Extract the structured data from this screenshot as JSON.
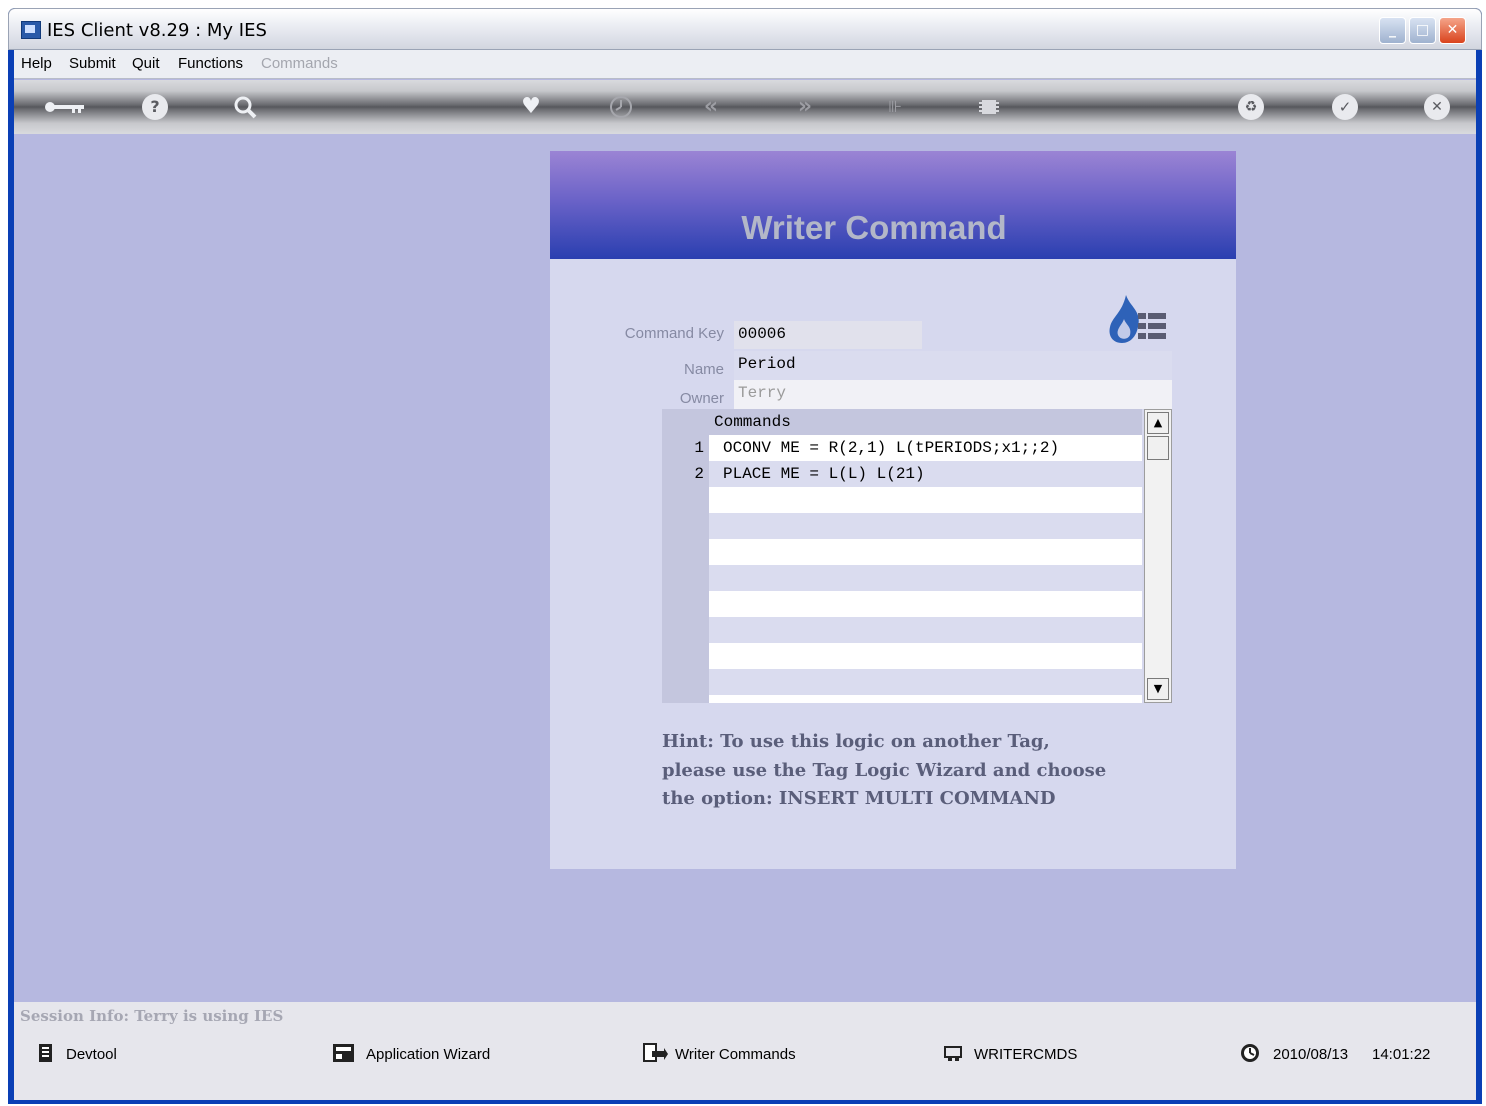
{
  "window": {
    "title": "IES Client v8.29 : My IES"
  },
  "menu": {
    "help": "Help",
    "submit": "Submit",
    "quit": "Quit",
    "functions": "Functions",
    "commands": "Commands"
  },
  "toolbar": {
    "key_icon": "key-icon",
    "help_icon": "question-icon",
    "search_icon": "search-icon",
    "heart_icon": "heart-icon",
    "clock_icon": "clock-icon",
    "prev_label": "«",
    "next_label": "»",
    "restore_icon": "recycle-icon",
    "confirm_icon": "check-icon",
    "close_icon": "x-icon"
  },
  "dialog": {
    "title": "Writer Command",
    "command_key_label": "Command Key",
    "command_key_value": "00006",
    "name_label": "Name",
    "name_value": "Period",
    "owner_label": "Owner",
    "owner_value": "Terry",
    "commands_header": "Commands",
    "commands": [
      {
        "num": "1",
        "text": "OCONV ME = R(2,1) L(tPERIODS;x1;;2)"
      },
      {
        "num": "2",
        "text": "PLACE ME = L(L) L(21)"
      }
    ],
    "hint_line1": "Hint: To use this logic on another Tag,",
    "hint_line2": "please use the Tag Logic Wizard and choose",
    "hint_line3": "the option: INSERT MULTI COMMAND"
  },
  "status": {
    "session": "Session Info: Terry is using IES",
    "devtool": "Devtool",
    "app_wizard": "Application Wizard",
    "writer_commands": "Writer Commands",
    "writercmds": "WRITERCMDS",
    "date": "2010/08/13",
    "time": "14:01:22"
  },
  "colors": {
    "client_bg": "#b6b8e0",
    "header_start": "#9b84d4",
    "header_end": "#2a3fb0",
    "dialog_bg": "#d6d8ee"
  }
}
